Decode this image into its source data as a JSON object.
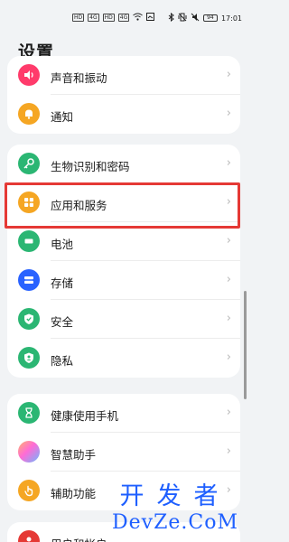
{
  "status_bar": {
    "left_boxes": [
      "HD",
      "4G",
      "HD",
      "4G"
    ],
    "wifi_icon": "wifi-icon",
    "battery": "94",
    "time": "17:01"
  },
  "page": {
    "title": "设置"
  },
  "groups": [
    {
      "items": [
        {
          "label": "声音和振动",
          "icon": "speaker-icon",
          "color": "#ff3b6b"
        },
        {
          "label": "通知",
          "icon": "bell-icon",
          "color": "#f5a623"
        }
      ]
    },
    {
      "items": [
        {
          "label": "生物识别和密码",
          "icon": "key-icon",
          "color": "#2bb673"
        },
        {
          "label": "应用和服务",
          "icon": "apps-icon",
          "color": "#f5a623"
        },
        {
          "label": "电池",
          "icon": "battery-icon",
          "color": "#2bb673"
        },
        {
          "label": "存储",
          "icon": "storage-icon",
          "color": "#2962ff"
        },
        {
          "label": "安全",
          "icon": "shield-icon",
          "color": "#2bb673"
        },
        {
          "label": "隐私",
          "icon": "privacy-icon",
          "color": "#2bb673"
        }
      ]
    },
    {
      "items": [
        {
          "label": "健康使用手机",
          "icon": "hourglass-icon",
          "color": "#2bb673"
        },
        {
          "label": "智慧助手",
          "icon": "assistant-icon",
          "color": "#b36bff"
        },
        {
          "label": "辅助功能",
          "icon": "hand-icon",
          "color": "#f5a623"
        }
      ]
    },
    {
      "items": [
        {
          "label": "用户和帐户",
          "icon": "user-icon",
          "color": "#e53935"
        }
      ]
    }
  ],
  "watermark": {
    "line1": "开发者",
    "line2": "DevZe.CoM"
  },
  "chevron": "›"
}
